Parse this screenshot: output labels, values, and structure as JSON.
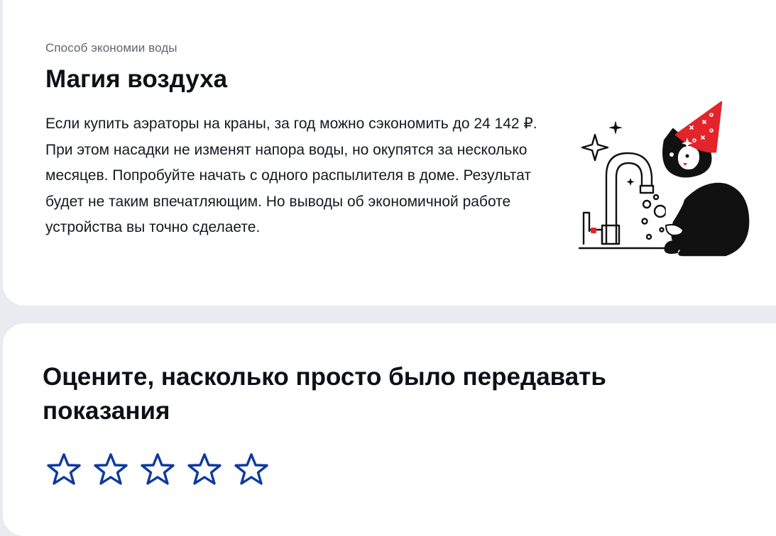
{
  "tip": {
    "eyebrow": "Способ экономии воды",
    "title": "Магия воздуха",
    "body": "Если купить аэраторы на краны, за год можно сэкономить до 24 142 ₽. При этом насадки не изменят напора воды, но окупятся за несколько месяцев. Попробуйте начать с одного распылителя в доме. Результат будет не таким впечатляющим. Но выводы об экономичной работе устройства вы точно сделаете.",
    "illustration": "cat-with-party-hat-at-faucet"
  },
  "rating": {
    "title": "Оцените, насколько просто было передавать показания",
    "max_stars": 5,
    "selected": 0,
    "star_icon": "star-outline-icon",
    "star_color": "#0d3a9e"
  },
  "colors": {
    "page_background": "#e8ebef",
    "card_background": "#ffffff",
    "accent_red": "#e3242b"
  }
}
